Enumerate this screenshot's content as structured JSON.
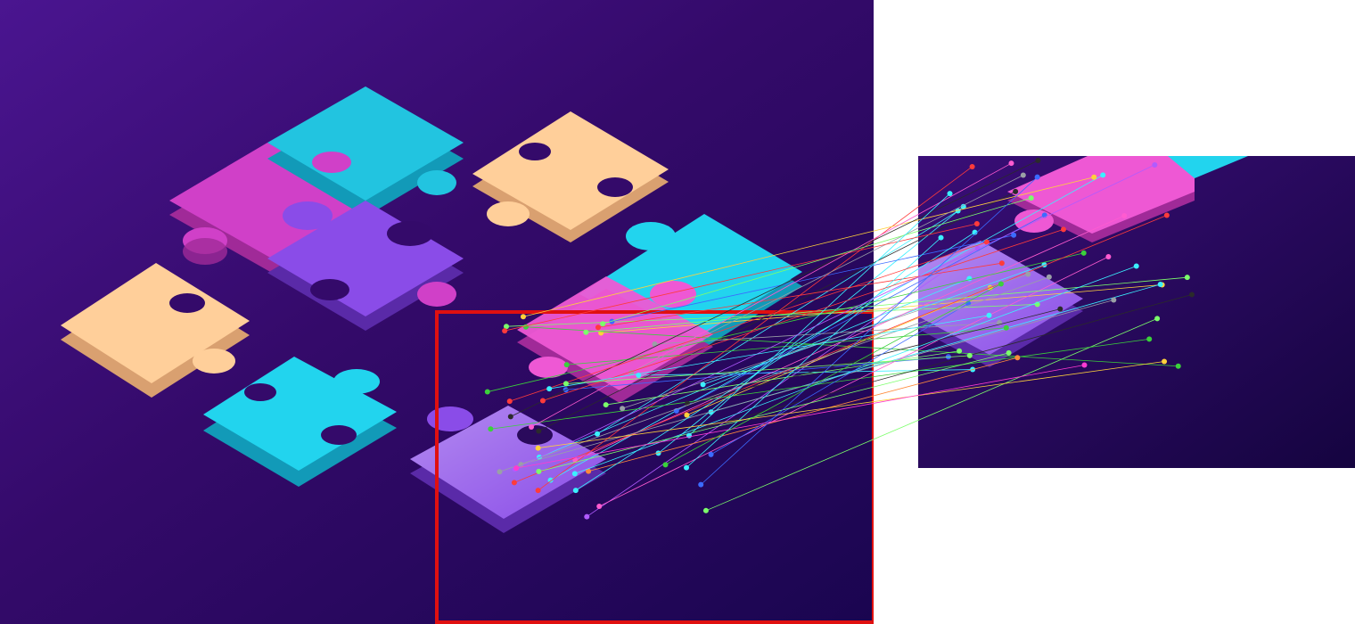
{
  "colors": {
    "background_dark": "#1a0550",
    "background_light": "#4a1590",
    "piece_cyan": "#22d4ee",
    "piece_magenta": "#d040c8",
    "piece_violet": "#8a4ce8",
    "piece_peach": "#ffcf9a",
    "region_box": "#e01010",
    "page_white": "#ffffff"
  },
  "scene": {
    "description_free": true,
    "left_panel": "source-image",
    "right_panel": "query-crop",
    "match_line_count": 55
  }
}
